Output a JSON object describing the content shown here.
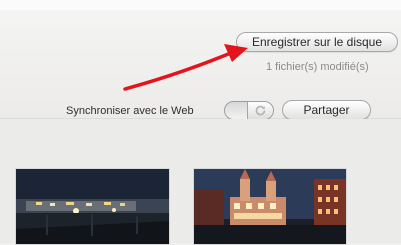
{
  "toolbar": {
    "save_label": "Enregistrer sur le disque",
    "status_text": "1 fichier(s) modifié(s)",
    "sync_label": "Synchroniser avec le Web",
    "share_label": "Partager"
  },
  "annotation": {
    "arrow_color": "#e3141b"
  },
  "photos": [
    {
      "icon": "night-city-photo"
    },
    {
      "icon": "kremlin-night-photo"
    }
  ]
}
